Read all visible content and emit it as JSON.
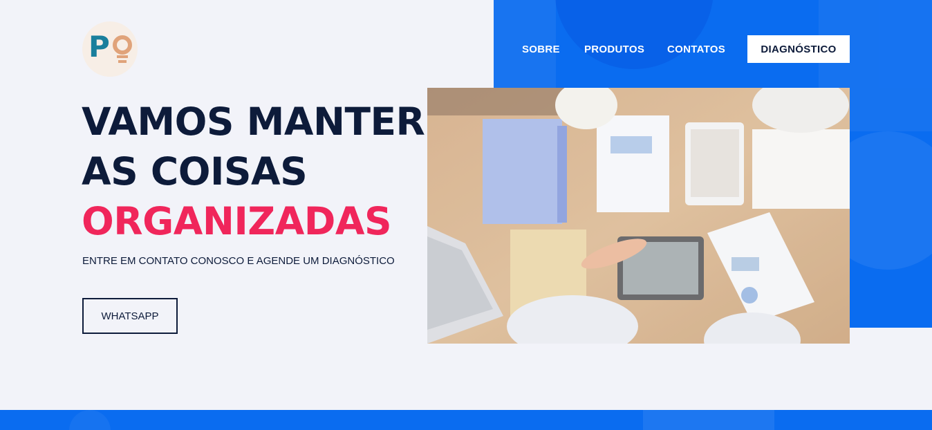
{
  "brand": {
    "logo_letter": "P"
  },
  "nav": {
    "items": [
      "SOBRE",
      "PRODUTOS",
      "CONTATOS"
    ],
    "cta": "DIAGNÓSTICO"
  },
  "hero": {
    "line1": "VAMOS MANTER",
    "line2": "AS COISAS",
    "line3": "ORGANIZADAS",
    "subtitle": "ENTRE EM CONTATO CONOSCO E AGENDE UM DIAGNÓSTICO",
    "button": "WHATSAPP"
  },
  "colors": {
    "primary_blue": "#0a6cf0",
    "accent_pink": "#f0265b",
    "dark_navy": "#0d1b3a",
    "background": "#f2f3f9"
  },
  "icons": [
    "logo-icon",
    "lightbulb-icon"
  ]
}
